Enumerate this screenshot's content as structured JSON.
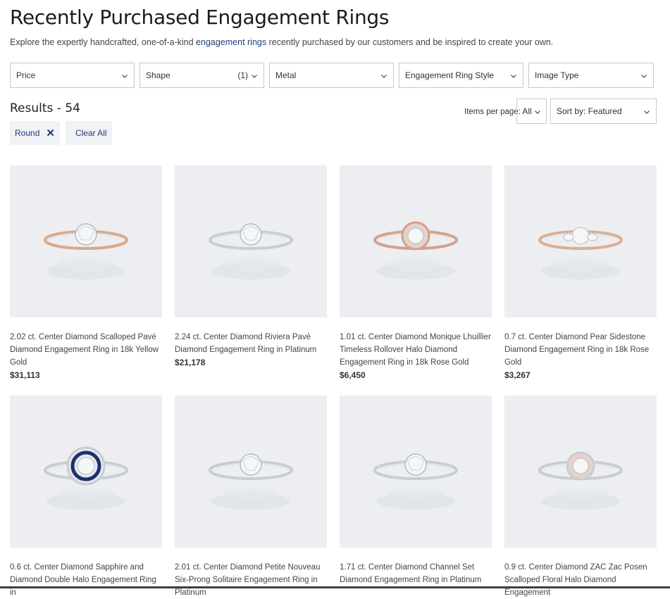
{
  "header": {
    "title": "Recently Purchased Engagement Rings",
    "subtitle_before": "Explore the expertly handcrafted, one-of-a-kind ",
    "subtitle_link": "engagement rings",
    "subtitle_after": " recently purchased by our customers and be inspired to create your own."
  },
  "filters": [
    {
      "label": "Price",
      "count": ""
    },
    {
      "label": "Shape",
      "count": "(1)"
    },
    {
      "label": "Metal",
      "count": ""
    },
    {
      "label": "Engagement Ring Style",
      "count": ""
    },
    {
      "label": "Image Type",
      "count": ""
    }
  ],
  "results": {
    "text": "Results - 54"
  },
  "active_filters": {
    "chip_label": "Round",
    "clear_label": "Clear All"
  },
  "pagination": {
    "items_per_page_label": "Items per page:",
    "items_per_page_value": "All"
  },
  "sort": {
    "label": "Sort by: Featured"
  },
  "products": [
    {
      "name": "2.02 ct. Center Diamond Scalloped Pavé Diamond Engagement Ring in 18k Yellow Gold",
      "price": "$31,113",
      "band": "#d9a98a",
      "style": "solitaire"
    },
    {
      "name": "2.24 ct. Center Diamond Riviera Pavé Diamond Engagement Ring in Platinum",
      "price": "$21,178",
      "band": "#c9cdd3",
      "style": "solitaire"
    },
    {
      "name": "1.01 ct. Center Diamond Monique Lhuillier Timeless Rollover Halo Diamond Engagement Ring in 18k Rose Gold",
      "price": "$6,450",
      "band": "#d6a08a",
      "style": "halo"
    },
    {
      "name": "0.7 ct. Center Diamond Pear Sidestone Diamond Engagement Ring in 18k Rose Gold",
      "price": "$3,267",
      "band": "#dcae92",
      "style": "three-stone"
    },
    {
      "name": "0.6 ct. Center Diamond Sapphire and Diamond Double Halo Engagement Ring in",
      "price": "",
      "band": "#c9cdd3",
      "style": "sapphire-halo"
    },
    {
      "name": "2.01 ct. Center Diamond Petite Nouveau Six-Prong Solitaire Engagement Ring in Platinum",
      "price": "",
      "band": "#c9cdd3",
      "style": "six-prong"
    },
    {
      "name": "1.71 ct. Center Diamond Channel Set Diamond Engagement Ring in Platinum",
      "price": "",
      "band": "#c9cdd3",
      "style": "channel"
    },
    {
      "name": "0.9 ct. Center Diamond ZAC Zac Posen Scalloped Floral Halo Diamond Engagement",
      "price": "",
      "band": "#c9cdd3",
      "style": "floral-halo"
    }
  ]
}
